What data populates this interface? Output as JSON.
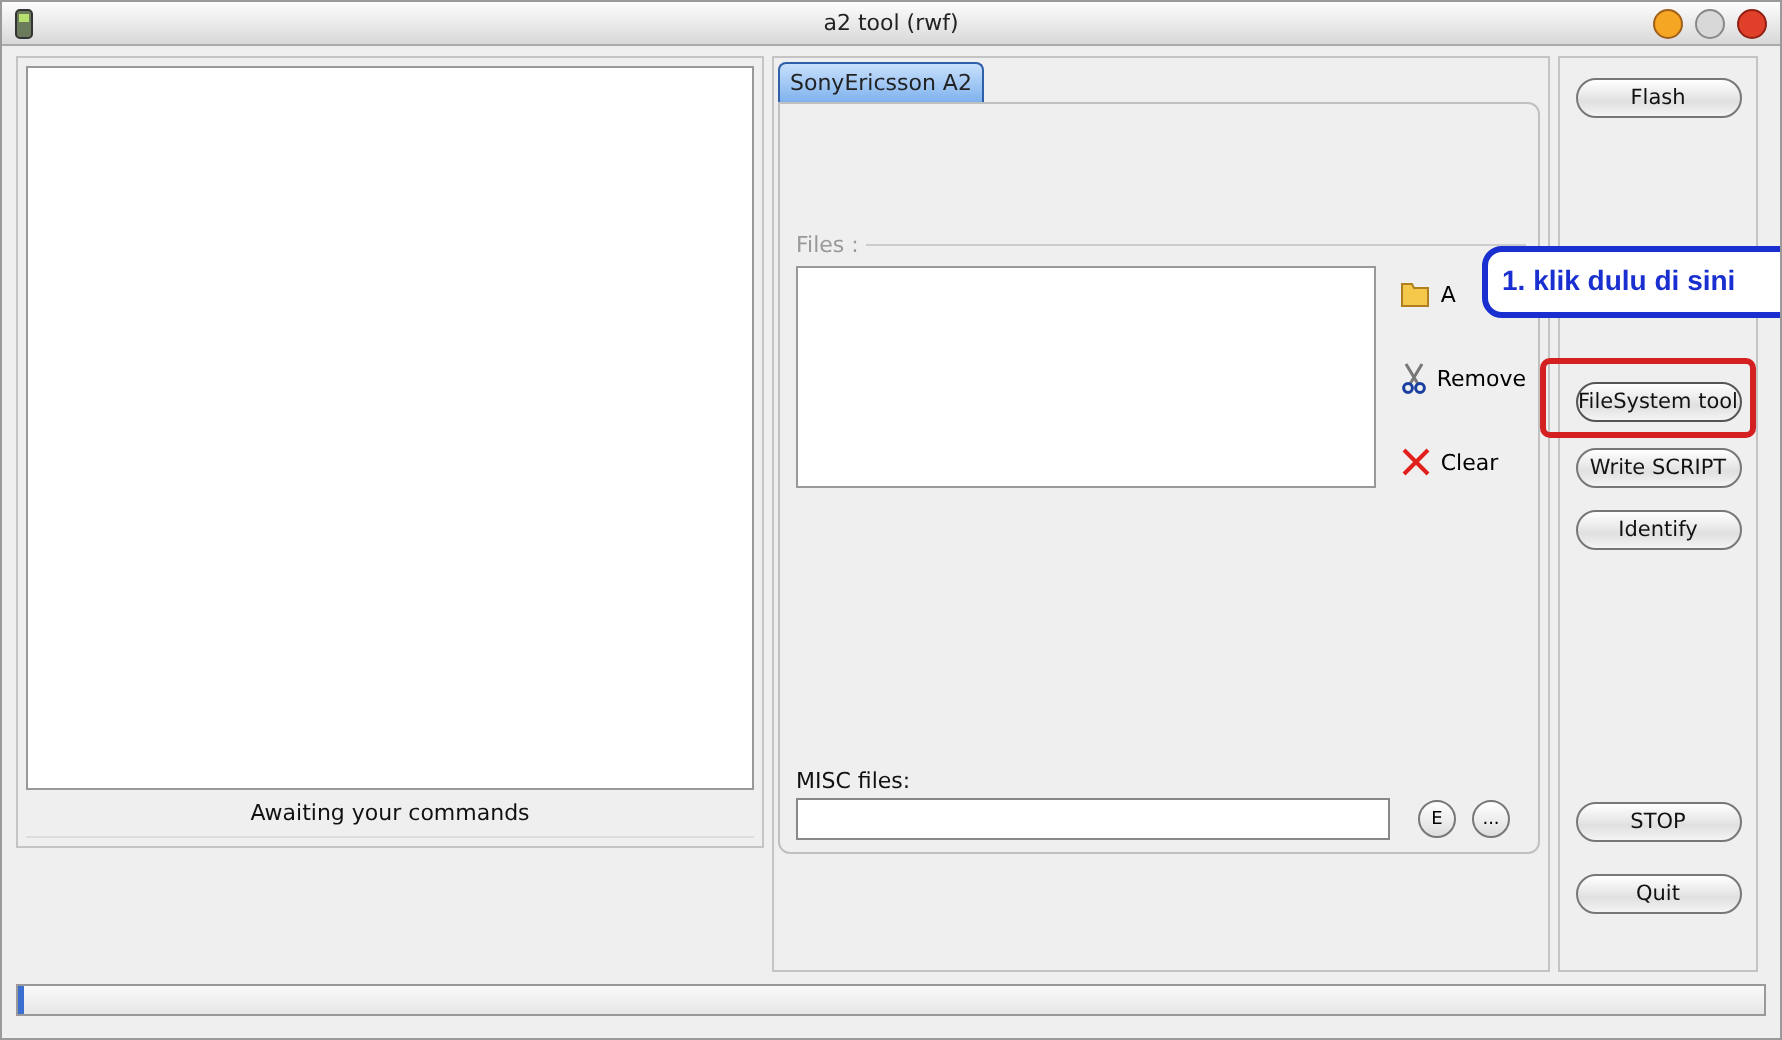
{
  "window": {
    "title": "a2 tool (rwf)"
  },
  "log": {
    "status": "Awaiting your commands"
  },
  "tabs": [
    {
      "label": "SonyEricsson A2",
      "selected": true
    }
  ],
  "files": {
    "label": "Files :",
    "actions": [
      {
        "label": "A",
        "kind": "folder"
      },
      {
        "label": "Remove",
        "kind": "scissors"
      },
      {
        "label": "Clear",
        "kind": "cross"
      }
    ]
  },
  "misc": {
    "label": "MISC files:",
    "buttons": [
      "E",
      "..."
    ]
  },
  "side_buttons": [
    {
      "label": "Flash",
      "highlighted": false
    },
    {
      "label": "FileSystem tool",
      "highlighted": true
    },
    {
      "label": "Write SCRIPT",
      "highlighted": false
    },
    {
      "label": "Identify",
      "highlighted": false
    },
    {
      "label": "STOP",
      "highlighted": false
    },
    {
      "label": "Quit",
      "highlighted": false
    }
  ],
  "callout": {
    "text": "1. klik dulu di sini"
  },
  "progress": {
    "level": 0.004
  }
}
